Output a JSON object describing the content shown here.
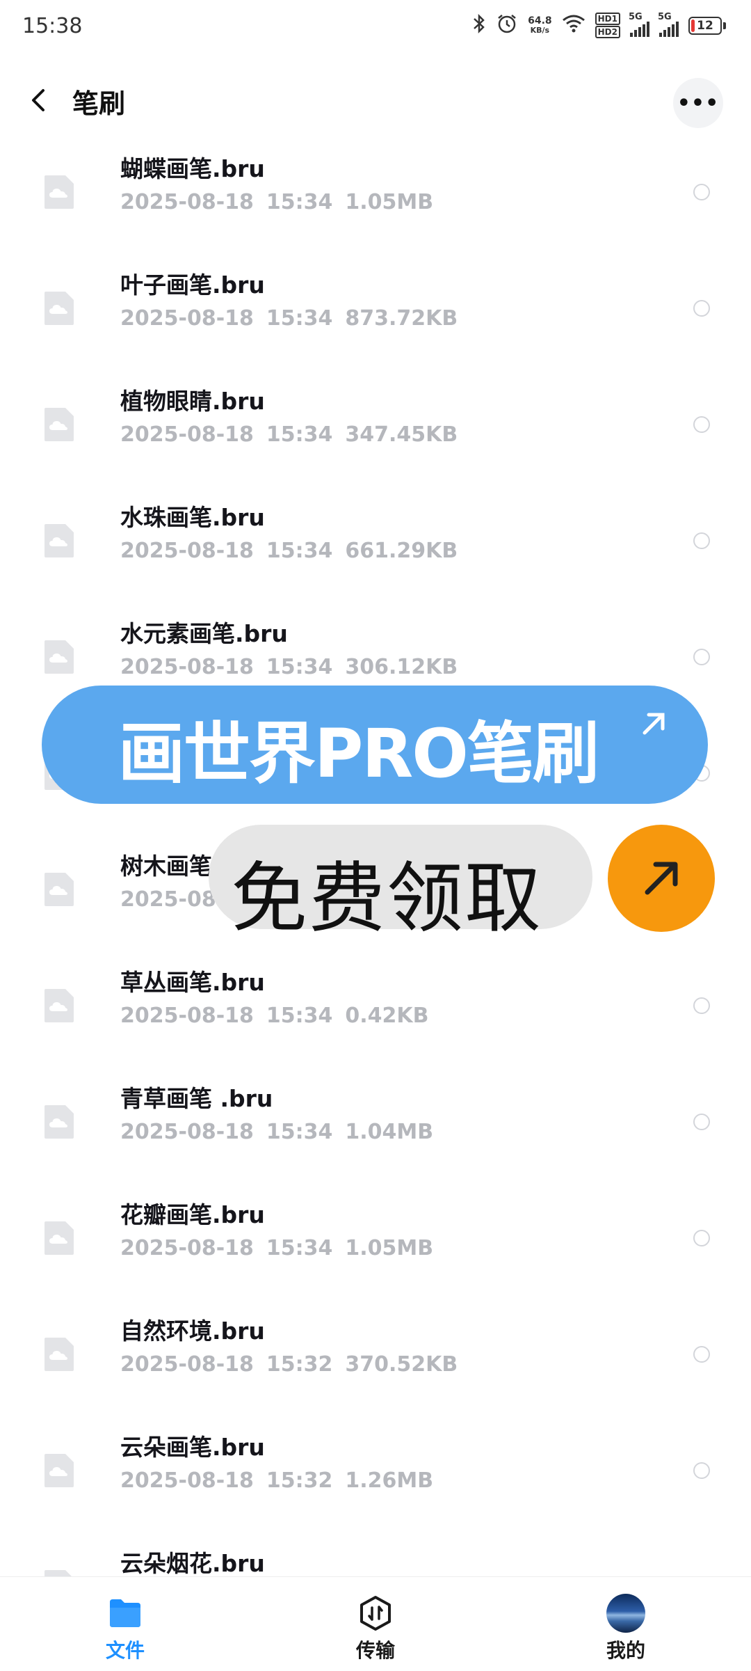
{
  "status_bar": {
    "time": "15:38",
    "net_speed_value": "64.8",
    "net_speed_unit": "KB/s",
    "hd1": "HD1",
    "hd2": "HD2",
    "sim1": "5G",
    "sim2": "5G",
    "battery": "12",
    "battery_level": 0.12,
    "battery_color": "#e53935"
  },
  "header": {
    "title": "笔刷",
    "more_label": "•••"
  },
  "files": [
    {
      "name": "蝴蝶画笔.bru",
      "date": "2025-08-18",
      "time": "15:34",
      "size": "1.05MB"
    },
    {
      "name": "叶子画笔.bru",
      "date": "2025-08-18",
      "time": "15:34",
      "size": "873.72KB"
    },
    {
      "name": "植物眼睛.bru",
      "date": "2025-08-18",
      "time": "15:34",
      "size": "347.45KB"
    },
    {
      "name": "水珠画笔.bru",
      "date": "2025-08-18",
      "time": "15:34",
      "size": "661.29KB"
    },
    {
      "name": "水元素画笔.bru",
      "date": "2025-08-18",
      "time": "15:34",
      "size": "306.12KB"
    },
    {
      "name": "",
      "date": "",
      "time": "",
      "size": ""
    },
    {
      "name": "树木画笔",
      "date": "2025-08",
      "time": "",
      "size": ""
    },
    {
      "name": "草丛画笔.bru",
      "date": "2025-08-18",
      "time": "15:34",
      "size": "0.42KB"
    },
    {
      "name": "青草画笔 .bru",
      "date": "2025-08-18",
      "time": "15:34",
      "size": "1.04MB"
    },
    {
      "name": "花瓣画笔.bru",
      "date": "2025-08-18",
      "time": "15:34",
      "size": "1.05MB"
    },
    {
      "name": "自然环境.bru",
      "date": "2025-08-18",
      "time": "15:32",
      "size": "370.52KB"
    },
    {
      "name": "云朵画笔.bru",
      "date": "2025-08-18",
      "time": "15:32",
      "size": "1.26MB"
    },
    {
      "name": "云朵烟花.bru",
      "date": "",
      "time": "",
      "size": ""
    }
  ],
  "promo": {
    "banner": "画世界PRO笔刷",
    "free": "免费领取",
    "banner_color": "#5ba8ee",
    "button_color": "#f7980d"
  },
  "bottom_nav": {
    "files": "文件",
    "transfer": "传输",
    "me": "我的",
    "active_color": "#1e90ff"
  }
}
